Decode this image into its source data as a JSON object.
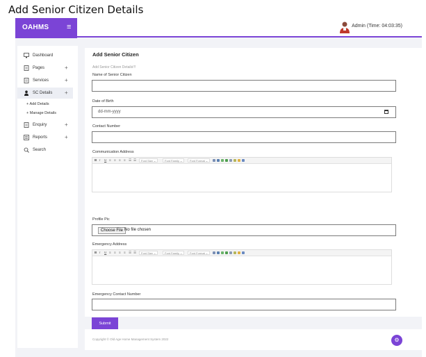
{
  "document_title": "Add Senior Citizen Details",
  "header": {
    "brand": "OAHMS",
    "menu_toggle_icon": "hamburger-icon",
    "admin_label": "Admin (Time: 04:03:35)",
    "avatar_icon": "user-avatar-icon"
  },
  "sidebar": {
    "items": [
      {
        "label": "Dashboard",
        "icon": "monitor-icon",
        "expandable": false
      },
      {
        "label": "Pages",
        "icon": "document-icon",
        "expandable": true
      },
      {
        "label": "Services",
        "icon": "document-icon",
        "expandable": true
      },
      {
        "label": "SC Details",
        "icon": "person-icon",
        "expandable": true,
        "active": true
      },
      {
        "label": "Enquiry",
        "icon": "document-icon",
        "expandable": true
      },
      {
        "label": "Reports",
        "icon": "report-icon",
        "expandable": true
      },
      {
        "label": "Search",
        "icon": "search-icon",
        "expandable": false
      }
    ],
    "sub_items": [
      "Add Details",
      "Manage Details"
    ],
    "expand_symbol": "+",
    "sub_bullet": "+"
  },
  "form": {
    "title": "Add Senior Citizen",
    "subtitle": "Add Senior Citizen Details!!!",
    "fields": {
      "name_label": "Name of Senior Citizen",
      "name_value": "",
      "dob_label": "Date of Birth",
      "dob_placeholder": "dd-mm-yyyy",
      "contact_label": "Contact Number",
      "contact_value": "",
      "address_label": "Communication Address",
      "profile_pic_label": "Profile Pic",
      "choose_file": "Choose File",
      "no_file": "No file chosen",
      "emergency_address_label": "Emergency Address",
      "emergency_contact_label": "Emergency Contact Number",
      "emergency_contact_value": ""
    },
    "editor_toolbar": {
      "bold": "B",
      "italic": "I",
      "underline": "U",
      "font_size": "Font Size",
      "font_family": "Font Family",
      "font_format": "Font Format"
    },
    "submit_label": "Submit"
  },
  "footer": {
    "copyright": "Copyright © Old Age Home Management System 2022",
    "fab_icon": "gear-icon"
  },
  "colors": {
    "accent": "#7b44d6",
    "page_bg": "#f2f3f7"
  }
}
